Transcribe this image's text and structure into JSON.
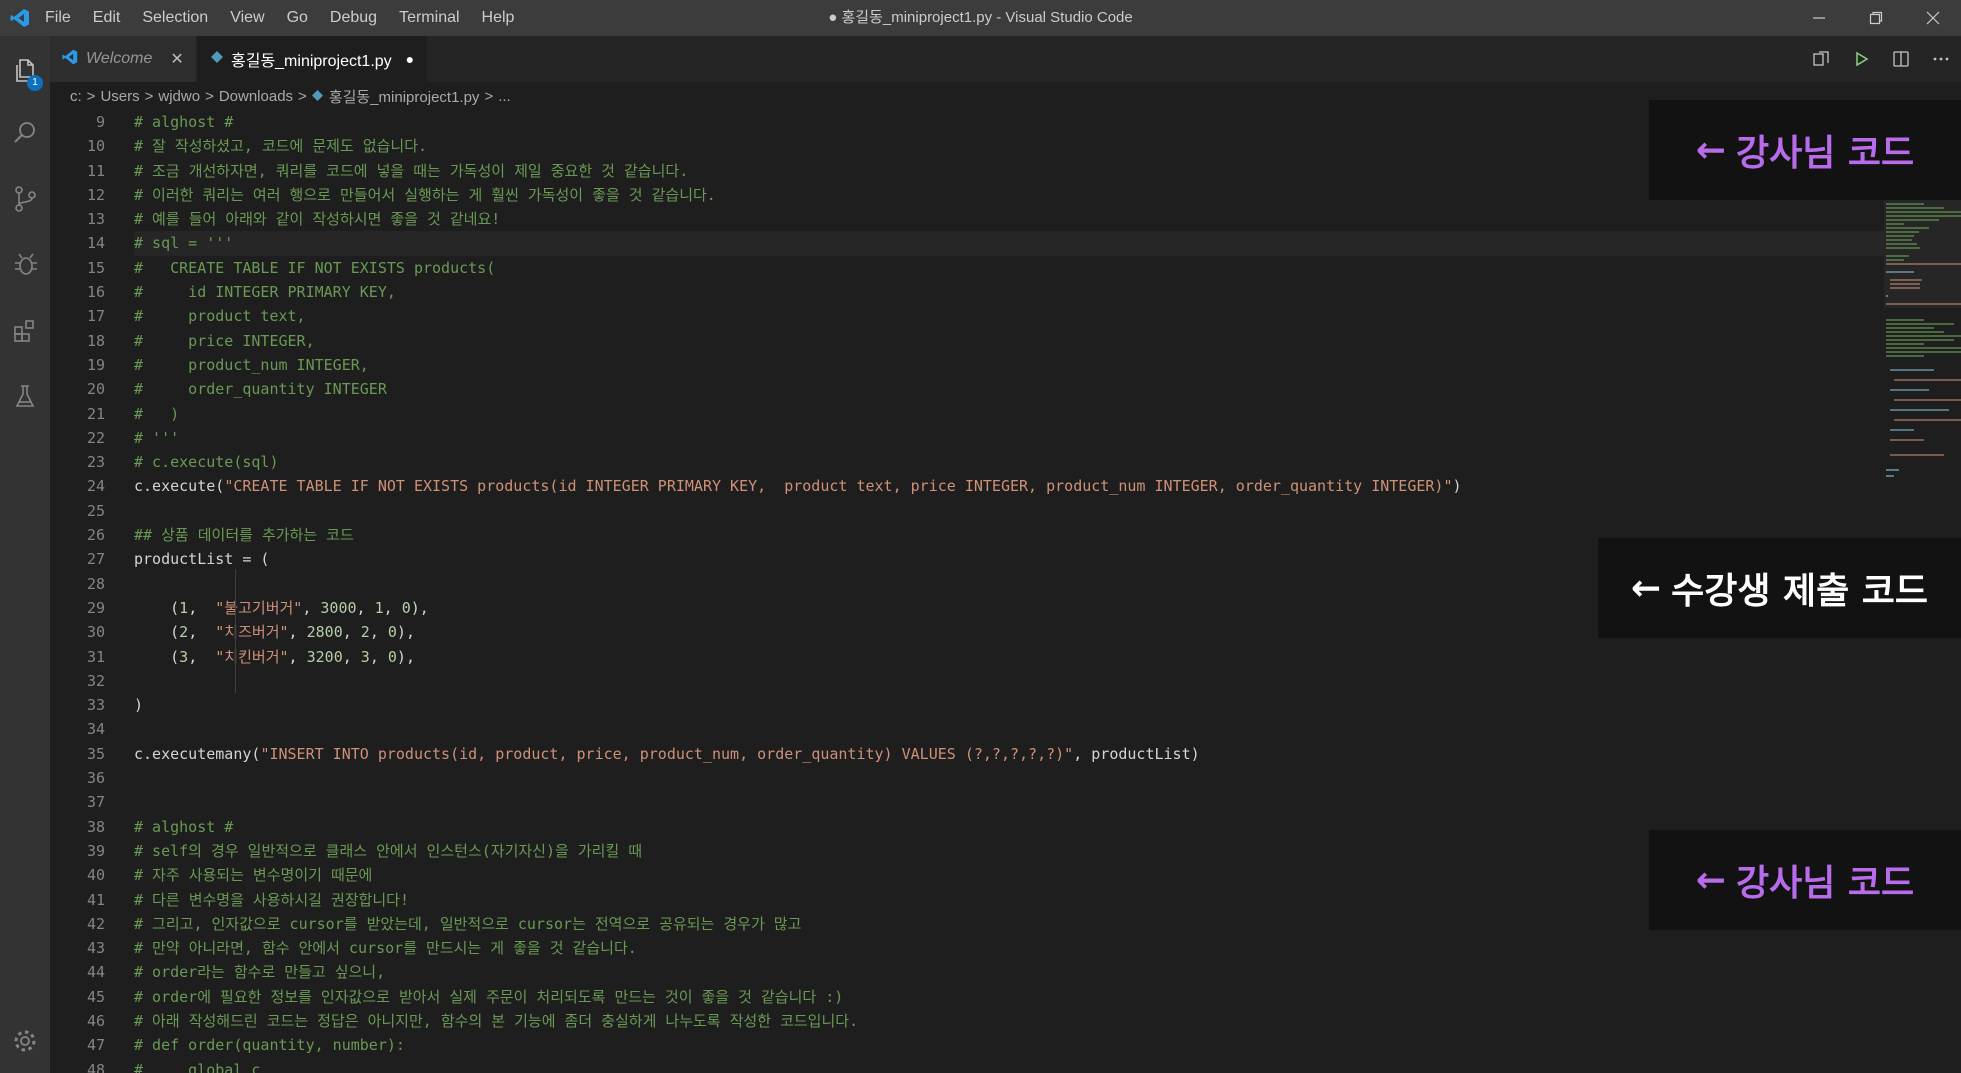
{
  "titlebar": {
    "logo_icon": "vscode-logo-icon",
    "menu": [
      "File",
      "Edit",
      "Selection",
      "View",
      "Go",
      "Debug",
      "Terminal",
      "Help"
    ],
    "window_title": "● 홍길동_miniproject1.py - Visual Studio Code",
    "controls": [
      "minimize-icon",
      "restore-icon",
      "close-icon"
    ]
  },
  "activity_bar": {
    "items": [
      "files-icon",
      "search-icon",
      "source-control-icon",
      "debug-icon",
      "extensions-icon",
      "testing-icon"
    ],
    "badge": "1",
    "bottom": "settings-gear-icon"
  },
  "tabs": [
    {
      "label": "Welcome",
      "close": "✕"
    },
    {
      "label": "홍길동_miniproject1.py",
      "dirty": "●"
    }
  ],
  "tab_actions": [
    "open-changes-icon",
    "run-icon",
    "split-editor-icon",
    "more-actions-icon"
  ],
  "breadcrumb": {
    "items": [
      "c:",
      "Users",
      "wjdwo",
      "Downloads",
      "홍길동_miniproject1.py",
      "..."
    ],
    "separator": ">"
  },
  "editor": {
    "line_numbers": [
      "9",
      "10",
      "11",
      "12",
      "13",
      "14",
      "15",
      "16",
      "17",
      "18",
      "19",
      "20",
      "21",
      "22",
      "23",
      "24",
      "25",
      "26",
      "27",
      "28",
      "29",
      "30",
      "31",
      "32",
      "33",
      "34",
      "35",
      "36",
      "37",
      "38",
      "39",
      "40",
      "41",
      "42",
      "43",
      "44",
      "45",
      "46",
      "47",
      "48"
    ],
    "lines": [
      "# alghost #",
      "# 잘 작성하셨고, 코드에 문제도 없습니다.",
      "# 조금 개선하자면, 쿼리를 코드에 넣을 때는 가독성이 제일 중요한 것 같습니다.",
      "# 이러한 쿼리는 여러 행으로 만들어서 실행하는 게 훨씬 가독성이 좋을 것 같습니다.",
      "# 예를 들어 아래와 같이 작성하시면 좋을 것 같네요!",
      "# sql = '''",
      "#   CREATE TABLE IF NOT EXISTS products(",
      "#     id INTEGER PRIMARY KEY,",
      "#     product text,",
      "#     price INTEGER,",
      "#     product_num INTEGER,",
      "#     order_quantity INTEGER",
      "#   )",
      "# '''",
      "# c.execute(sql)",
      "c.execute(\"CREATE TABLE IF NOT EXISTS products(id INTEGER PRIMARY KEY,  product text, price INTEGER, product_num INTEGER, order_quantity INTEGER)\")",
      "",
      "## 상품 데이터를 추가하는 코드",
      "productList = (",
      "",
      "    (1,  \"불고기버거\", 3000, 1, 0),",
      "    (2,  \"치즈버거\", 2800, 2, 0),",
      "    (3,  \"치킨버거\", 3200, 3, 0),",
      "",
      ")",
      "",
      "c.executemany(\"INSERT INTO products(id, product, price, product_num, order_quantity) VALUES (?,?,?,?,?)\", productList)",
      "",
      "",
      "# alghost #",
      "# self의 경우 일반적으로 클래스 안에서 인스턴스(자기자신)을 가리킬 때",
      "# 자주 사용되는 변수명이기 때문에",
      "# 다른 변수명을 사용하시길 권장합니다!",
      "# 그리고, 인자값으로 cursor를 받았는데, 일반적으로 cursor는 전역으로 공유되는 경우가 많고",
      "# 만약 아니라면, 함수 안에서 cursor를 만드시는 게 좋을 것 같습니다.",
      "# order라는 함수로 만들고 싶으니,",
      "# order에 필요한 정보를 인자값으로 받아서 실제 주문이 처리되도록 만드는 것이 좋을 것 같습니다 :)",
      "# 아래 작성해드린 코드는 정답은 아니지만, 함수의 본 기능에 좀더 충실하게 나누도록 작성한 코드입니다.",
      "# def order(quantity, number):",
      "#     global c"
    ]
  },
  "annotations": [
    {
      "arrow": "←",
      "text": "강사님 코드",
      "color": "#b86bea"
    },
    {
      "arrow": "←",
      "text": "수강생 제출 코드",
      "color": "#ffffff"
    },
    {
      "arrow": "←",
      "text": "강사님 코드",
      "color": "#b86bea"
    }
  ]
}
